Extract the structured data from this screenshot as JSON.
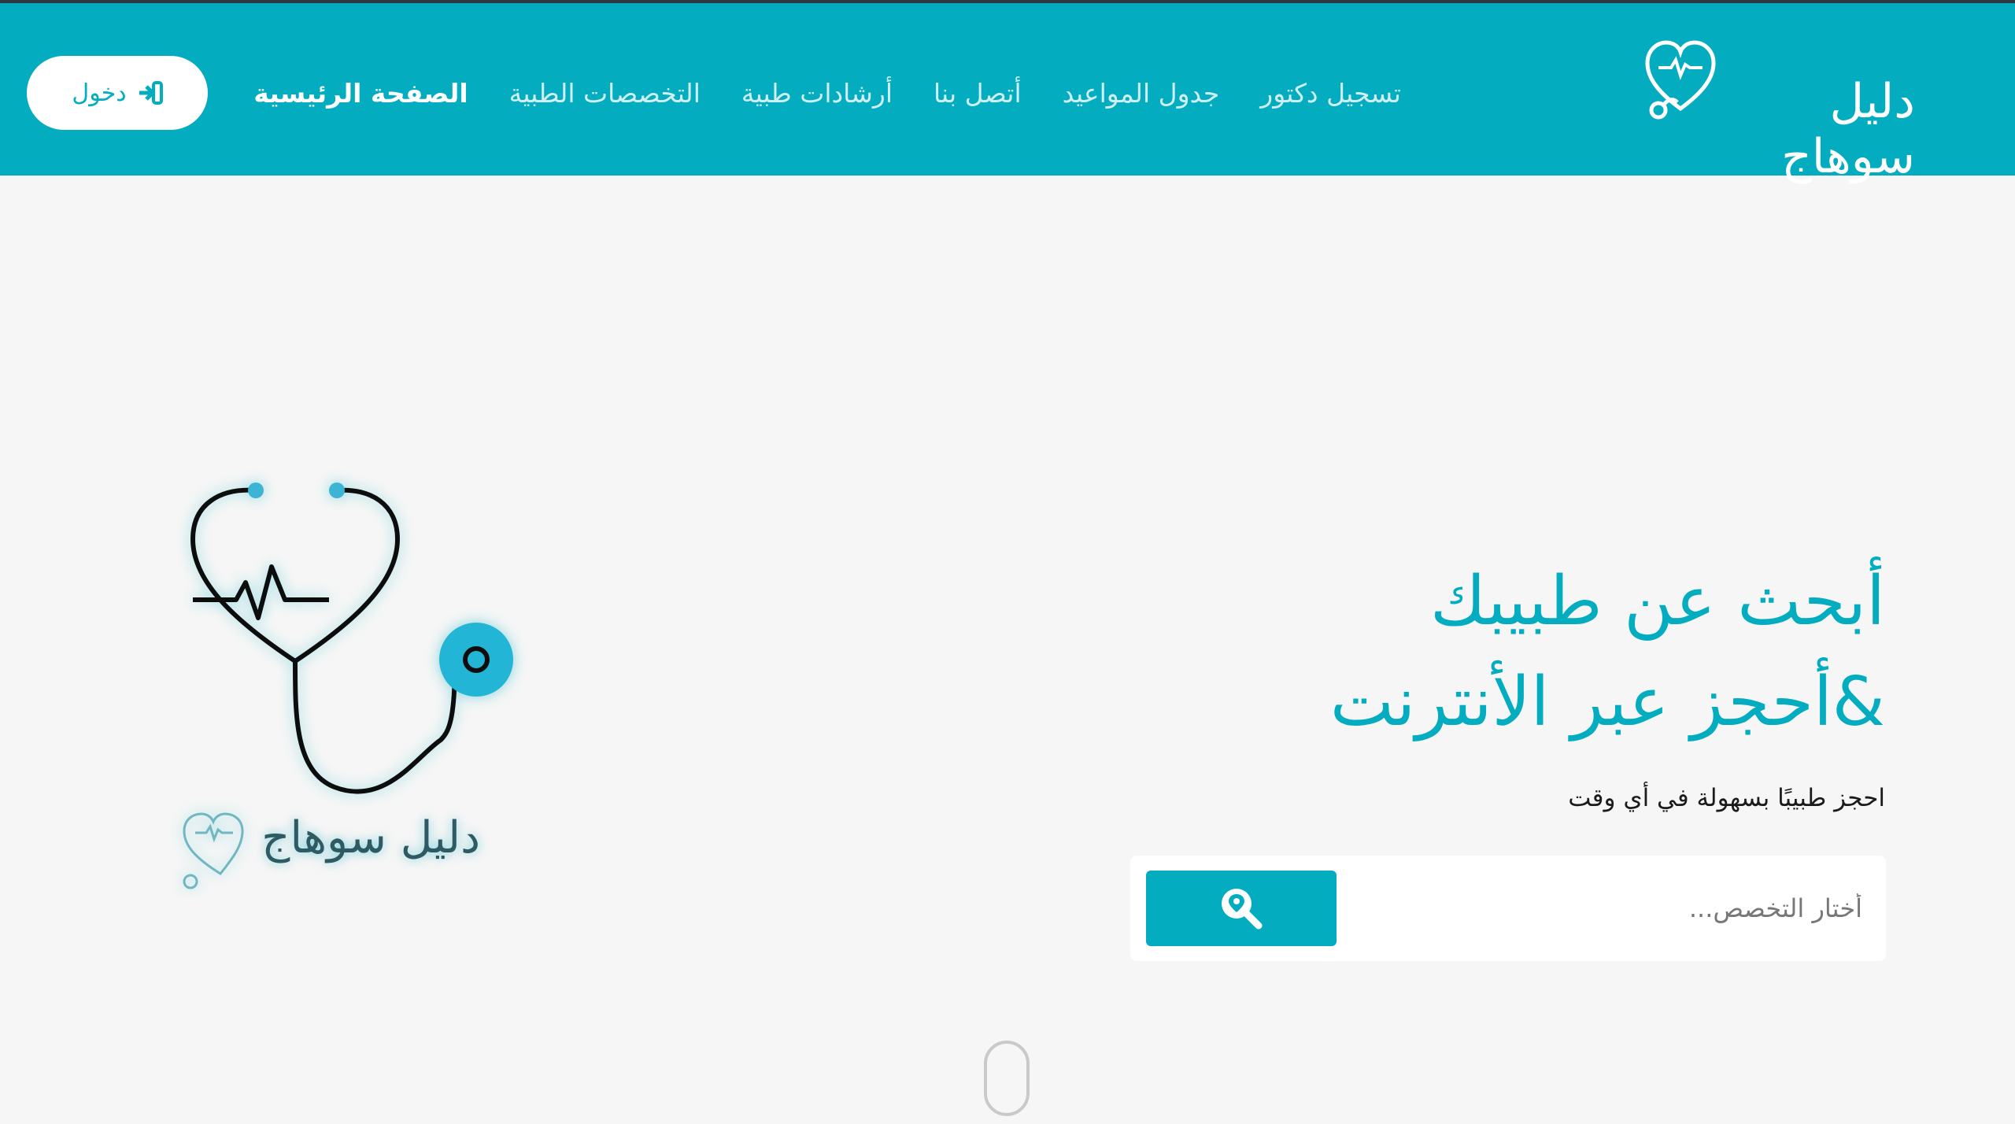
{
  "brand": {
    "name": "دليل سوهاج",
    "icon": "heart-stethoscope-logo"
  },
  "nav": {
    "items": [
      {
        "label": "الصفحة الرئيسية",
        "active": true
      },
      {
        "label": "التخصصات الطبية",
        "active": false
      },
      {
        "label": "أرشادات طبية",
        "active": false
      },
      {
        "label": "أتصل بنا",
        "active": false
      },
      {
        "label": "جدول المواعيد",
        "active": false
      },
      {
        "label": "تسجيل دكتور",
        "active": false
      }
    ],
    "login_label": "دخول",
    "login_icon": "sign-in-icon"
  },
  "hero": {
    "title_line1": "أبحث عن طبيبك",
    "title_line2": "&أحجز عبر الأنترنت",
    "subtitle": "احجز طبيبًا بسهولة في أي وقت",
    "search_placeholder": "أختار التخصص...",
    "search_icon": "search-location-icon"
  },
  "illustration": {
    "brand_name": "دليل سوهاج",
    "icon": "stethoscope-heartbeat-icon"
  },
  "colors": {
    "primary": "#03acbf",
    "background": "#f6f6f6",
    "text_dark": "#1b1b1b"
  }
}
